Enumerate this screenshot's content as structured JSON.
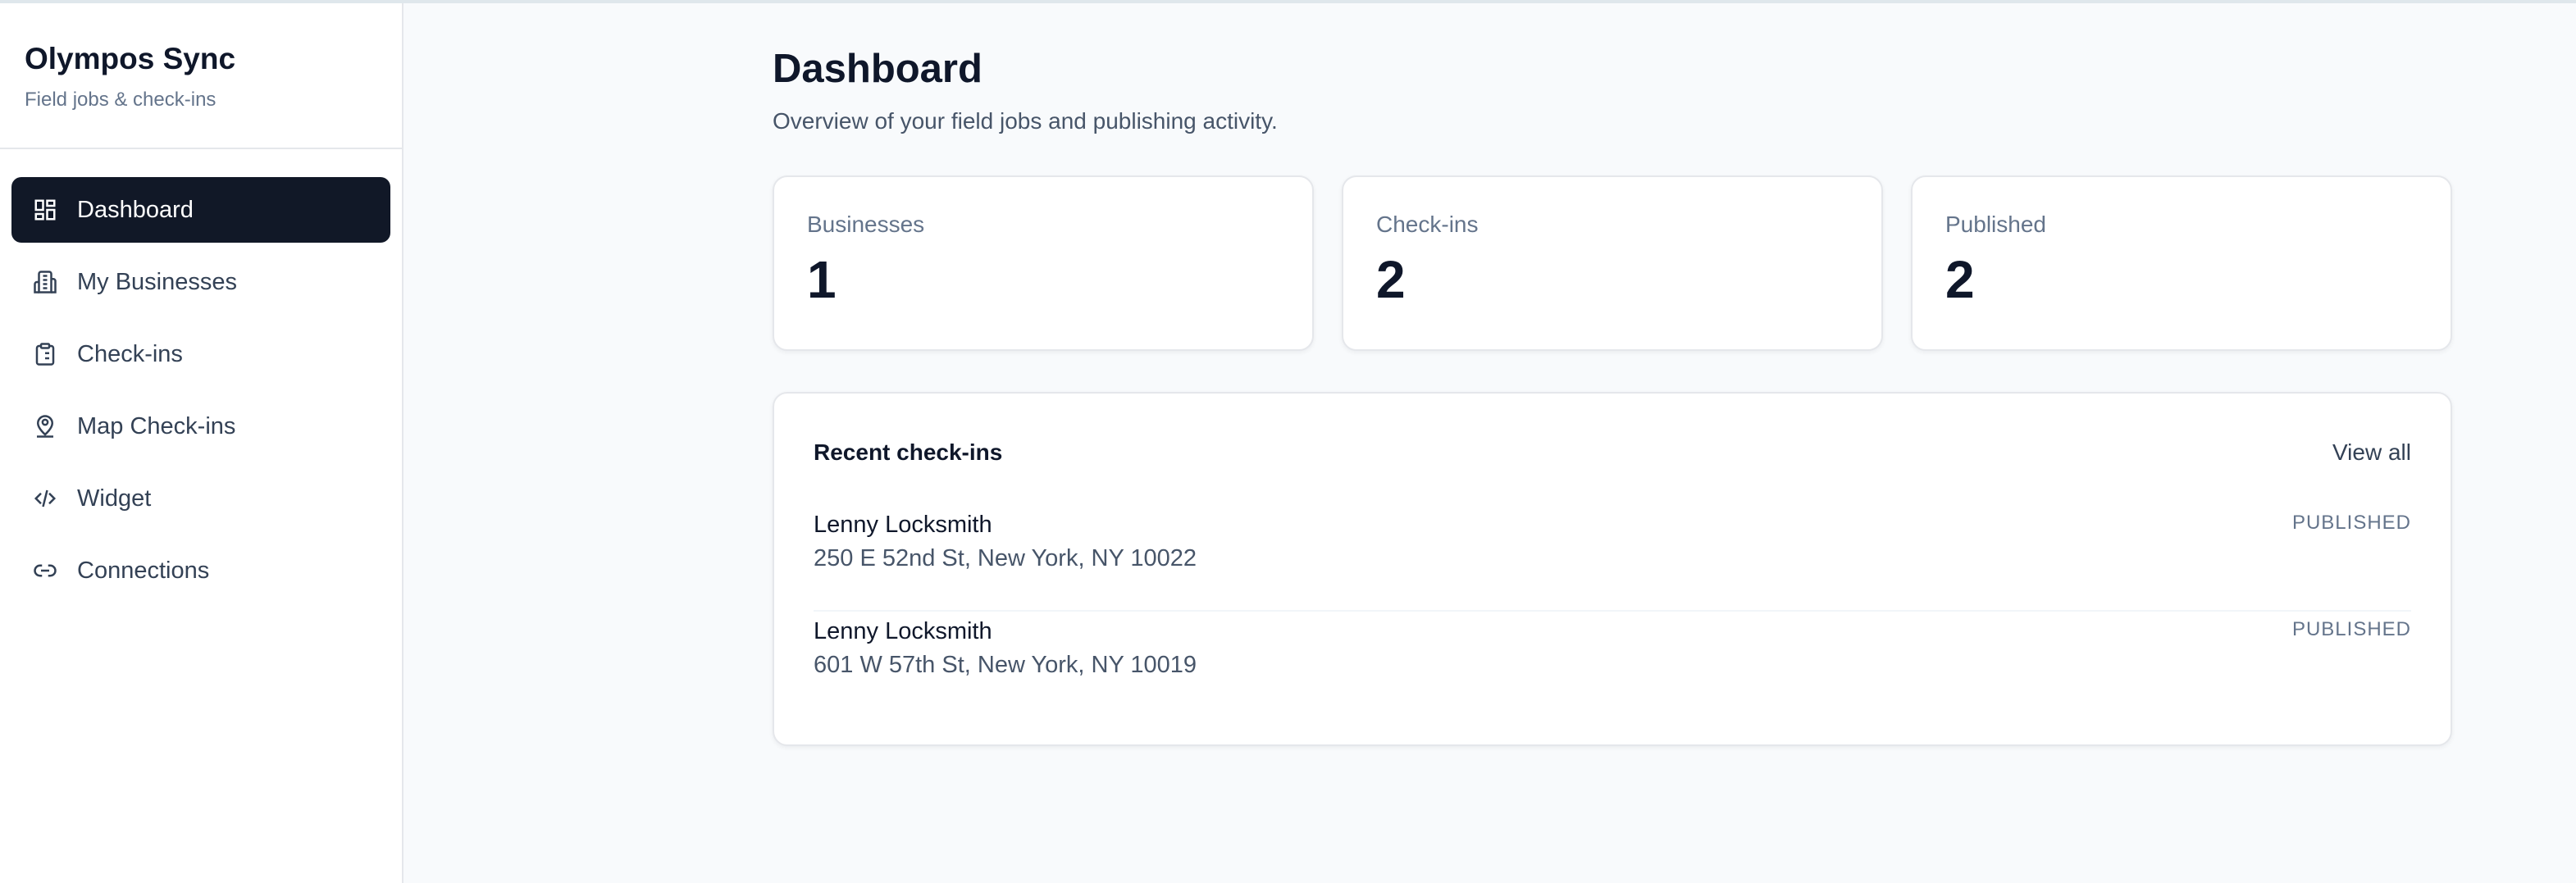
{
  "sidebar": {
    "title": "Olympos Sync",
    "subtitle": "Field jobs & check-ins",
    "items": [
      {
        "label": "Dashboard",
        "icon": "dashboard-icon",
        "active": true
      },
      {
        "label": "My Businesses",
        "icon": "building-icon",
        "active": false
      },
      {
        "label": "Check-ins",
        "icon": "clipboard-icon",
        "active": false
      },
      {
        "label": "Map Check-ins",
        "icon": "map-pin-user-icon",
        "active": false
      },
      {
        "label": "Widget",
        "icon": "code-icon",
        "active": false
      },
      {
        "label": "Connections",
        "icon": "link-icon",
        "active": false
      }
    ]
  },
  "header": {
    "title": "Dashboard",
    "subtitle": "Overview of your field jobs and publishing activity."
  },
  "stats": [
    {
      "label": "Businesses",
      "value": "1"
    },
    {
      "label": "Check-ins",
      "value": "2"
    },
    {
      "label": "Published",
      "value": "2"
    }
  ],
  "recent": {
    "title": "Recent check-ins",
    "view_all": "View all",
    "rows": [
      {
        "name": "Lenny Locksmith",
        "address": "250 E 52nd St, New York, NY 10022",
        "status": "PUBLISHED"
      },
      {
        "name": "Lenny Locksmith",
        "address": "601 W 57th St, New York, NY 10019",
        "status": "PUBLISHED"
      }
    ]
  },
  "colors": {
    "active_nav_bg": "#111827",
    "page_bg": "#f8fafc",
    "card_bg": "#ffffff",
    "muted_text": "#64748b"
  }
}
